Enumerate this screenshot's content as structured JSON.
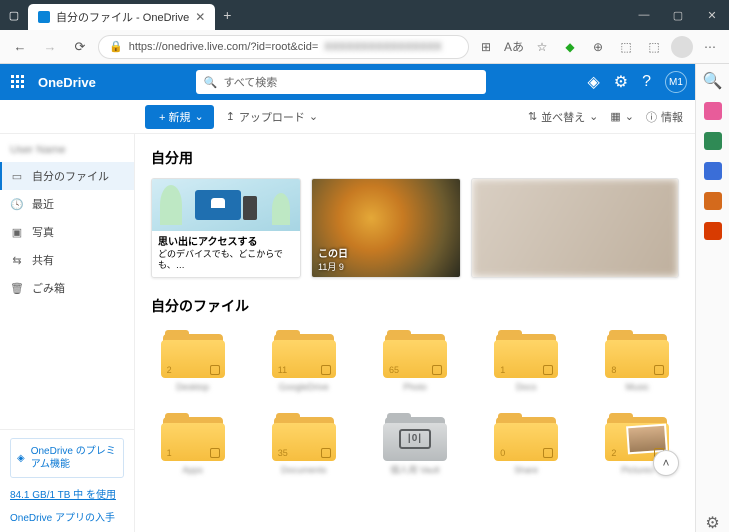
{
  "window": {
    "tab_title": "自分のファイル - OneDrive"
  },
  "url": {
    "lock": "🔒",
    "host": "https://onedrive.live.com/?id=root&cid=",
    "rest": "XXXXXXXXXXXXXXXX"
  },
  "appbar": {
    "brand": "OneDrive",
    "search_placeholder": "すべて検索",
    "avatar": "M1"
  },
  "toolbar": {
    "new": "+ 新規",
    "upload": "アップロード",
    "sort": "並べ替え",
    "info": "情報"
  },
  "sidebar": {
    "user": "User Name",
    "items": [
      {
        "icon": "folder",
        "label": "自分のファイル",
        "active": true
      },
      {
        "icon": "clock",
        "label": "最近"
      },
      {
        "icon": "image",
        "label": "写真"
      },
      {
        "icon": "share",
        "label": "共有"
      },
      {
        "icon": "trash",
        "label": "ごみ箱"
      }
    ],
    "premium": "OneDrive のプレミアム機能",
    "storage": "84.1 GB/1 TB 中 を使用",
    "getapp": "OneDrive アプリの入手"
  },
  "sections": {
    "foryou": "自分用",
    "myfiles": "自分のファイル"
  },
  "cards": {
    "memories_title": "思い出にアクセスする",
    "memories_sub": "どのデバイスでも、どこからでも、…",
    "thisday_title": "この日",
    "thisday_sub": "11月 9"
  },
  "folders_row1": [
    {
      "count": "2",
      "label": "Desktop"
    },
    {
      "count": "11",
      "label": "GoogleDrive"
    },
    {
      "count": "65",
      "label": "Photo"
    },
    {
      "count": "1",
      "label": "Docs"
    },
    {
      "count": "8",
      "label": "Music"
    }
  ],
  "folders_row2": [
    {
      "count": "1",
      "label": "Apps",
      "type": "folder"
    },
    {
      "count": "35",
      "label": "Documents",
      "type": "folder"
    },
    {
      "count": "",
      "label": "個人用 Vault",
      "type": "vault",
      "dial": "|0|"
    },
    {
      "count": "0",
      "label": "Share",
      "type": "folder"
    },
    {
      "count": "2",
      "label": "Pictures",
      "type": "photo"
    }
  ]
}
